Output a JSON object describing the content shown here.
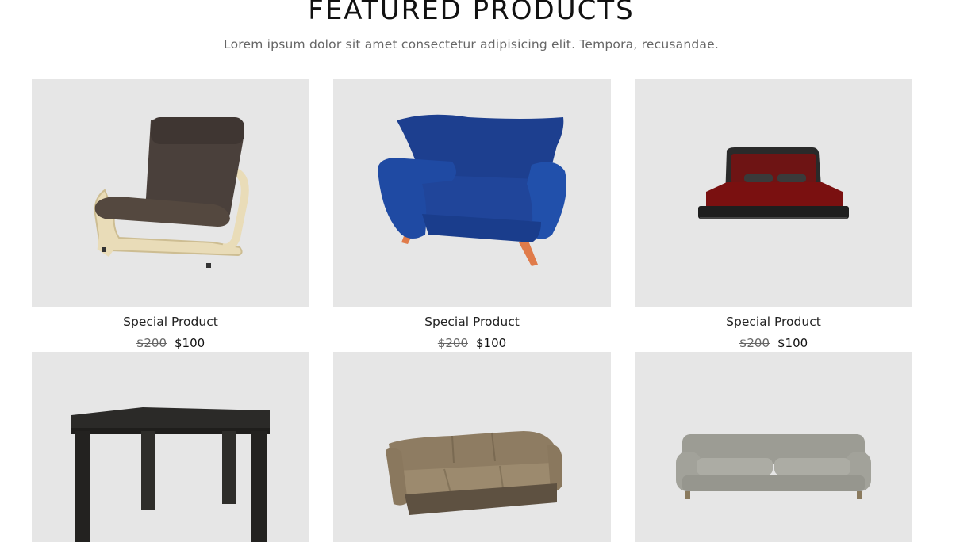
{
  "section": {
    "title": "FEATURED PRODUCTS",
    "subtitle": "Lorem ipsum dolor sit amet consectetur adipisicing elit. Tempora, recusandae."
  },
  "products": [
    {
      "name": "Special Product",
      "old_price": "$200",
      "price": "$100",
      "image": "armchair-poang"
    },
    {
      "name": "Special Product",
      "old_price": "$200",
      "price": "$100",
      "image": "blue-armchair"
    },
    {
      "name": "Special Product",
      "old_price": "$200",
      "price": "$100",
      "image": "bed"
    },
    {
      "name": "",
      "old_price": "",
      "price": "",
      "image": "black-table"
    },
    {
      "name": "",
      "old_price": "",
      "price": "",
      "image": "brown-sofa"
    },
    {
      "name": "",
      "old_price": "",
      "price": "",
      "image": "grey-sofa"
    }
  ],
  "colors": {
    "card_background": "#e6e6e6",
    "price_old": "#666666",
    "price_new": "#111111"
  }
}
